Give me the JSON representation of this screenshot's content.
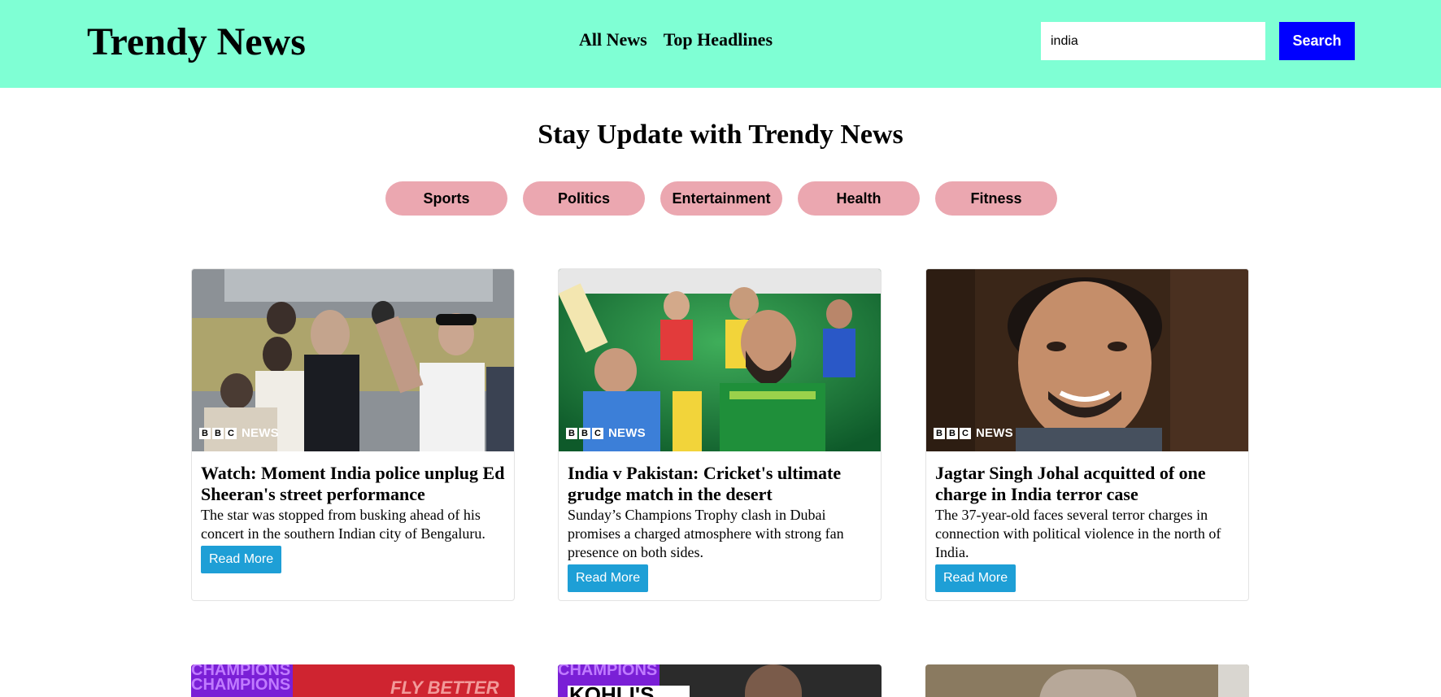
{
  "header": {
    "brand": "Trendy News",
    "nav": [
      "All News",
      "Top Headlines"
    ],
    "search_value": "india",
    "search_button": "Search",
    "background_color": "#7fffd4",
    "search_button_color": "#0000ff"
  },
  "main": {
    "headline": "Stay Update with Trendy News",
    "categories": [
      "Sports",
      "Politics",
      "Entertainment",
      "Health",
      "Fitness"
    ],
    "category_color": "#eba7b0"
  },
  "articles": [
    {
      "title": "Watch: Moment India police unplug Ed Sheeran's street performance",
      "description": "The star was stopped from busking ahead of his concert in the southern Indian city of Bengaluru.",
      "button": "Read More",
      "image_brand": "NEWS"
    },
    {
      "title": "India v Pakistan: Cricket's ultimate grudge match in the desert",
      "description": "Sunday’s Champions Trophy clash in Dubai promises a charged atmosphere with strong fan presence on both sides.",
      "button": "Read More",
      "image_brand": "NEWS"
    },
    {
      "title": "Jagtar Singh Johal acquitted of one charge in India terror case",
      "description": "The 37-year-old faces several terror charges in connection with political violence in the north of India.",
      "button": "Read More",
      "image_brand": "NEWS"
    }
  ],
  "partial_articles": {
    "card1_text": "CHAMPIONS",
    "card1_overlay": "FLY BETTER",
    "card2_text": "CHAMPIONS",
    "card2_overlay": "KOHLI'S"
  },
  "read_more_color": "#1e9fd6"
}
